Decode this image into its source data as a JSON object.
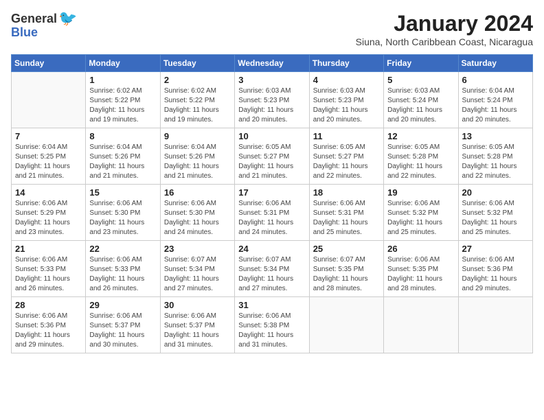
{
  "logo": {
    "general": "General",
    "blue": "Blue",
    "tagline": ""
  },
  "title": {
    "month": "January 2024",
    "location": "Siuna, North Caribbean Coast, Nicaragua"
  },
  "weekdays": [
    "Sunday",
    "Monday",
    "Tuesday",
    "Wednesday",
    "Thursday",
    "Friday",
    "Saturday"
  ],
  "weeks": [
    [
      {
        "day": "",
        "info": ""
      },
      {
        "day": "1",
        "info": "Sunrise: 6:02 AM\nSunset: 5:22 PM\nDaylight: 11 hours\nand 19 minutes."
      },
      {
        "day": "2",
        "info": "Sunrise: 6:02 AM\nSunset: 5:22 PM\nDaylight: 11 hours\nand 19 minutes."
      },
      {
        "day": "3",
        "info": "Sunrise: 6:03 AM\nSunset: 5:23 PM\nDaylight: 11 hours\nand 20 minutes."
      },
      {
        "day": "4",
        "info": "Sunrise: 6:03 AM\nSunset: 5:23 PM\nDaylight: 11 hours\nand 20 minutes."
      },
      {
        "day": "5",
        "info": "Sunrise: 6:03 AM\nSunset: 5:24 PM\nDaylight: 11 hours\nand 20 minutes."
      },
      {
        "day": "6",
        "info": "Sunrise: 6:04 AM\nSunset: 5:24 PM\nDaylight: 11 hours\nand 20 minutes."
      }
    ],
    [
      {
        "day": "7",
        "info": "Sunrise: 6:04 AM\nSunset: 5:25 PM\nDaylight: 11 hours\nand 21 minutes."
      },
      {
        "day": "8",
        "info": "Sunrise: 6:04 AM\nSunset: 5:26 PM\nDaylight: 11 hours\nand 21 minutes."
      },
      {
        "day": "9",
        "info": "Sunrise: 6:04 AM\nSunset: 5:26 PM\nDaylight: 11 hours\nand 21 minutes."
      },
      {
        "day": "10",
        "info": "Sunrise: 6:05 AM\nSunset: 5:27 PM\nDaylight: 11 hours\nand 21 minutes."
      },
      {
        "day": "11",
        "info": "Sunrise: 6:05 AM\nSunset: 5:27 PM\nDaylight: 11 hours\nand 22 minutes."
      },
      {
        "day": "12",
        "info": "Sunrise: 6:05 AM\nSunset: 5:28 PM\nDaylight: 11 hours\nand 22 minutes."
      },
      {
        "day": "13",
        "info": "Sunrise: 6:05 AM\nSunset: 5:28 PM\nDaylight: 11 hours\nand 22 minutes."
      }
    ],
    [
      {
        "day": "14",
        "info": "Sunrise: 6:06 AM\nSunset: 5:29 PM\nDaylight: 11 hours\nand 23 minutes."
      },
      {
        "day": "15",
        "info": "Sunrise: 6:06 AM\nSunset: 5:30 PM\nDaylight: 11 hours\nand 23 minutes."
      },
      {
        "day": "16",
        "info": "Sunrise: 6:06 AM\nSunset: 5:30 PM\nDaylight: 11 hours\nand 24 minutes."
      },
      {
        "day": "17",
        "info": "Sunrise: 6:06 AM\nSunset: 5:31 PM\nDaylight: 11 hours\nand 24 minutes."
      },
      {
        "day": "18",
        "info": "Sunrise: 6:06 AM\nSunset: 5:31 PM\nDaylight: 11 hours\nand 25 minutes."
      },
      {
        "day": "19",
        "info": "Sunrise: 6:06 AM\nSunset: 5:32 PM\nDaylight: 11 hours\nand 25 minutes."
      },
      {
        "day": "20",
        "info": "Sunrise: 6:06 AM\nSunset: 5:32 PM\nDaylight: 11 hours\nand 25 minutes."
      }
    ],
    [
      {
        "day": "21",
        "info": "Sunrise: 6:06 AM\nSunset: 5:33 PM\nDaylight: 11 hours\nand 26 minutes."
      },
      {
        "day": "22",
        "info": "Sunrise: 6:06 AM\nSunset: 5:33 PM\nDaylight: 11 hours\nand 26 minutes."
      },
      {
        "day": "23",
        "info": "Sunrise: 6:07 AM\nSunset: 5:34 PM\nDaylight: 11 hours\nand 27 minutes."
      },
      {
        "day": "24",
        "info": "Sunrise: 6:07 AM\nSunset: 5:34 PM\nDaylight: 11 hours\nand 27 minutes."
      },
      {
        "day": "25",
        "info": "Sunrise: 6:07 AM\nSunset: 5:35 PM\nDaylight: 11 hours\nand 28 minutes."
      },
      {
        "day": "26",
        "info": "Sunrise: 6:06 AM\nSunset: 5:35 PM\nDaylight: 11 hours\nand 28 minutes."
      },
      {
        "day": "27",
        "info": "Sunrise: 6:06 AM\nSunset: 5:36 PM\nDaylight: 11 hours\nand 29 minutes."
      }
    ],
    [
      {
        "day": "28",
        "info": "Sunrise: 6:06 AM\nSunset: 5:36 PM\nDaylight: 11 hours\nand 29 minutes."
      },
      {
        "day": "29",
        "info": "Sunrise: 6:06 AM\nSunset: 5:37 PM\nDaylight: 11 hours\nand 30 minutes."
      },
      {
        "day": "30",
        "info": "Sunrise: 6:06 AM\nSunset: 5:37 PM\nDaylight: 11 hours\nand 31 minutes."
      },
      {
        "day": "31",
        "info": "Sunrise: 6:06 AM\nSunset: 5:38 PM\nDaylight: 11 hours\nand 31 minutes."
      },
      {
        "day": "",
        "info": ""
      },
      {
        "day": "",
        "info": ""
      },
      {
        "day": "",
        "info": ""
      }
    ]
  ]
}
